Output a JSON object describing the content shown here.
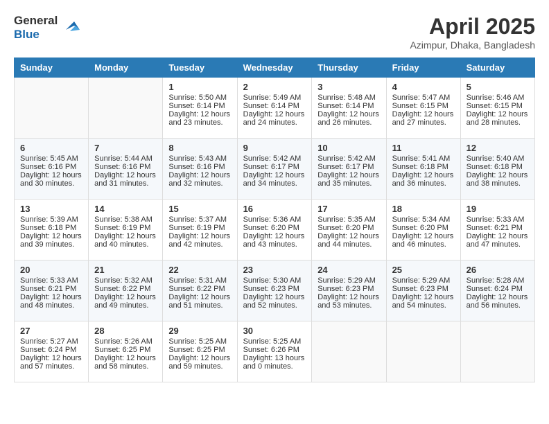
{
  "header": {
    "logo_general": "General",
    "logo_blue": "Blue",
    "title": "April 2025",
    "location": "Azimpur, Dhaka, Bangladesh"
  },
  "weekdays": [
    "Sunday",
    "Monday",
    "Tuesday",
    "Wednesday",
    "Thursday",
    "Friday",
    "Saturday"
  ],
  "weeks": [
    [
      {
        "day": "",
        "sunrise": "",
        "sunset": "",
        "daylight": ""
      },
      {
        "day": "",
        "sunrise": "",
        "sunset": "",
        "daylight": ""
      },
      {
        "day": "1",
        "sunrise": "Sunrise: 5:50 AM",
        "sunset": "Sunset: 6:14 PM",
        "daylight": "Daylight: 12 hours and 23 minutes."
      },
      {
        "day": "2",
        "sunrise": "Sunrise: 5:49 AM",
        "sunset": "Sunset: 6:14 PM",
        "daylight": "Daylight: 12 hours and 24 minutes."
      },
      {
        "day": "3",
        "sunrise": "Sunrise: 5:48 AM",
        "sunset": "Sunset: 6:14 PM",
        "daylight": "Daylight: 12 hours and 26 minutes."
      },
      {
        "day": "4",
        "sunrise": "Sunrise: 5:47 AM",
        "sunset": "Sunset: 6:15 PM",
        "daylight": "Daylight: 12 hours and 27 minutes."
      },
      {
        "day": "5",
        "sunrise": "Sunrise: 5:46 AM",
        "sunset": "Sunset: 6:15 PM",
        "daylight": "Daylight: 12 hours and 28 minutes."
      }
    ],
    [
      {
        "day": "6",
        "sunrise": "Sunrise: 5:45 AM",
        "sunset": "Sunset: 6:16 PM",
        "daylight": "Daylight: 12 hours and 30 minutes."
      },
      {
        "day": "7",
        "sunrise": "Sunrise: 5:44 AM",
        "sunset": "Sunset: 6:16 PM",
        "daylight": "Daylight: 12 hours and 31 minutes."
      },
      {
        "day": "8",
        "sunrise": "Sunrise: 5:43 AM",
        "sunset": "Sunset: 6:16 PM",
        "daylight": "Daylight: 12 hours and 32 minutes."
      },
      {
        "day": "9",
        "sunrise": "Sunrise: 5:42 AM",
        "sunset": "Sunset: 6:17 PM",
        "daylight": "Daylight: 12 hours and 34 minutes."
      },
      {
        "day": "10",
        "sunrise": "Sunrise: 5:42 AM",
        "sunset": "Sunset: 6:17 PM",
        "daylight": "Daylight: 12 hours and 35 minutes."
      },
      {
        "day": "11",
        "sunrise": "Sunrise: 5:41 AM",
        "sunset": "Sunset: 6:18 PM",
        "daylight": "Daylight: 12 hours and 36 minutes."
      },
      {
        "day": "12",
        "sunrise": "Sunrise: 5:40 AM",
        "sunset": "Sunset: 6:18 PM",
        "daylight": "Daylight: 12 hours and 38 minutes."
      }
    ],
    [
      {
        "day": "13",
        "sunrise": "Sunrise: 5:39 AM",
        "sunset": "Sunset: 6:18 PM",
        "daylight": "Daylight: 12 hours and 39 minutes."
      },
      {
        "day": "14",
        "sunrise": "Sunrise: 5:38 AM",
        "sunset": "Sunset: 6:19 PM",
        "daylight": "Daylight: 12 hours and 40 minutes."
      },
      {
        "day": "15",
        "sunrise": "Sunrise: 5:37 AM",
        "sunset": "Sunset: 6:19 PM",
        "daylight": "Daylight: 12 hours and 42 minutes."
      },
      {
        "day": "16",
        "sunrise": "Sunrise: 5:36 AM",
        "sunset": "Sunset: 6:20 PM",
        "daylight": "Daylight: 12 hours and 43 minutes."
      },
      {
        "day": "17",
        "sunrise": "Sunrise: 5:35 AM",
        "sunset": "Sunset: 6:20 PM",
        "daylight": "Daylight: 12 hours and 44 minutes."
      },
      {
        "day": "18",
        "sunrise": "Sunrise: 5:34 AM",
        "sunset": "Sunset: 6:20 PM",
        "daylight": "Daylight: 12 hours and 46 minutes."
      },
      {
        "day": "19",
        "sunrise": "Sunrise: 5:33 AM",
        "sunset": "Sunset: 6:21 PM",
        "daylight": "Daylight: 12 hours and 47 minutes."
      }
    ],
    [
      {
        "day": "20",
        "sunrise": "Sunrise: 5:33 AM",
        "sunset": "Sunset: 6:21 PM",
        "daylight": "Daylight: 12 hours and 48 minutes."
      },
      {
        "day": "21",
        "sunrise": "Sunrise: 5:32 AM",
        "sunset": "Sunset: 6:22 PM",
        "daylight": "Daylight: 12 hours and 49 minutes."
      },
      {
        "day": "22",
        "sunrise": "Sunrise: 5:31 AM",
        "sunset": "Sunset: 6:22 PM",
        "daylight": "Daylight: 12 hours and 51 minutes."
      },
      {
        "day": "23",
        "sunrise": "Sunrise: 5:30 AM",
        "sunset": "Sunset: 6:23 PM",
        "daylight": "Daylight: 12 hours and 52 minutes."
      },
      {
        "day": "24",
        "sunrise": "Sunrise: 5:29 AM",
        "sunset": "Sunset: 6:23 PM",
        "daylight": "Daylight: 12 hours and 53 minutes."
      },
      {
        "day": "25",
        "sunrise": "Sunrise: 5:29 AM",
        "sunset": "Sunset: 6:23 PM",
        "daylight": "Daylight: 12 hours and 54 minutes."
      },
      {
        "day": "26",
        "sunrise": "Sunrise: 5:28 AM",
        "sunset": "Sunset: 6:24 PM",
        "daylight": "Daylight: 12 hours and 56 minutes."
      }
    ],
    [
      {
        "day": "27",
        "sunrise": "Sunrise: 5:27 AM",
        "sunset": "Sunset: 6:24 PM",
        "daylight": "Daylight: 12 hours and 57 minutes."
      },
      {
        "day": "28",
        "sunrise": "Sunrise: 5:26 AM",
        "sunset": "Sunset: 6:25 PM",
        "daylight": "Daylight: 12 hours and 58 minutes."
      },
      {
        "day": "29",
        "sunrise": "Sunrise: 5:25 AM",
        "sunset": "Sunset: 6:25 PM",
        "daylight": "Daylight: 12 hours and 59 minutes."
      },
      {
        "day": "30",
        "sunrise": "Sunrise: 5:25 AM",
        "sunset": "Sunset: 6:26 PM",
        "daylight": "Daylight: 13 hours and 0 minutes."
      },
      {
        "day": "",
        "sunrise": "",
        "sunset": "",
        "daylight": ""
      },
      {
        "day": "",
        "sunrise": "",
        "sunset": "",
        "daylight": ""
      },
      {
        "day": "",
        "sunrise": "",
        "sunset": "",
        "daylight": ""
      }
    ]
  ]
}
